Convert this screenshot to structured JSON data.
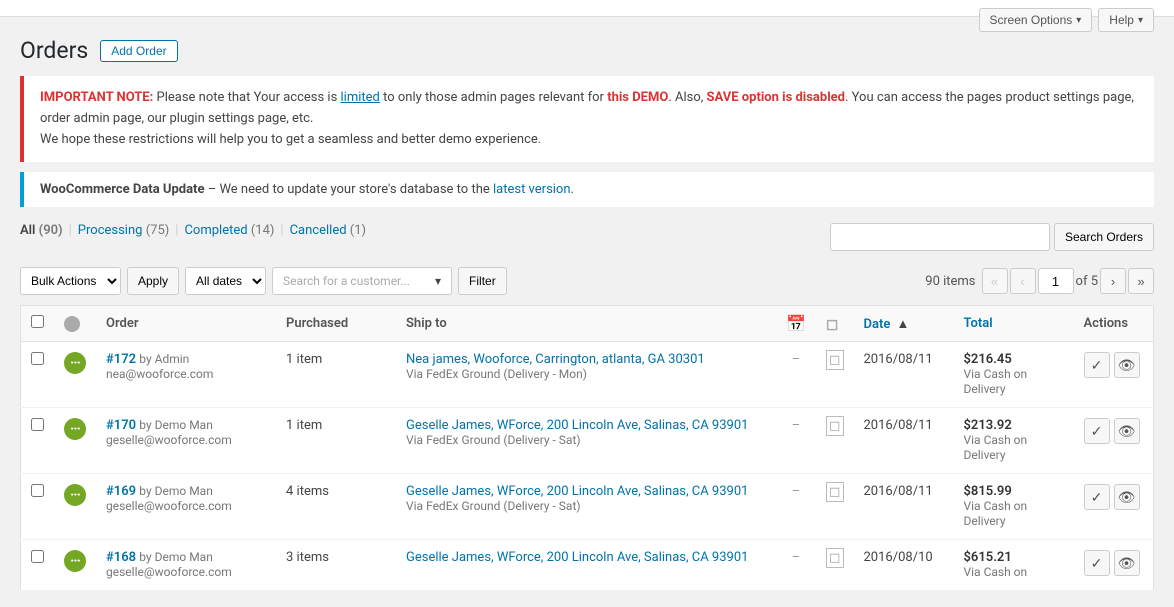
{
  "topBar": {
    "screenOptions": "Screen Options",
    "help": "Help"
  },
  "pageTitle": "Orders",
  "addOrderBtn": "Add Order",
  "notice": {
    "errorText1": "IMPORTANT NOTE: Please note that Your access is",
    "errorTextLink": "limited",
    "errorText2": "to only those admin pages relevant for",
    "errorTextStrong": "this DEMO",
    "errorText3": ". Also,",
    "errorTextStrong2": "SAVE option is disabled",
    "errorText4": ". You can access the pages product settings page, order admin page, our plugin settings page, etc.",
    "errorText5": "We hope these restrictions will help you to get a seamless and better demo experience."
  },
  "updateNotice": {
    "boldText": "WooCommerce Data Update",
    "text": " – We need to update your store's database to the",
    "linkText": "latest version",
    "period": "."
  },
  "filterTabs": [
    {
      "label": "All",
      "count": "90",
      "active": true
    },
    {
      "label": "Processing",
      "count": "75",
      "active": false
    },
    {
      "label": "Completed",
      "count": "14",
      "active": false
    },
    {
      "label": "Cancelled",
      "count": "1",
      "active": false
    }
  ],
  "actions": {
    "bulkActionsLabel": "Bulk Actions",
    "applyLabel": "Apply",
    "allDatesLabel": "All dates",
    "customerSearchPlaceholder": "Search for a customer...",
    "filterLabel": "Filter"
  },
  "pagination": {
    "itemsCount": "90 items",
    "currentPage": "1",
    "totalPages": "5"
  },
  "searchOrders": {
    "placeholder": "",
    "buttonLabel": "Search Orders"
  },
  "tableHeaders": {
    "order": "Order",
    "purchased": "Purchased",
    "shipTo": "Ship to",
    "date": "Date",
    "sortArrow": "▲",
    "total": "Total",
    "actions": "Actions"
  },
  "orders": [
    {
      "id": "#172",
      "by": "by Admin",
      "email": "nea@wooforce.com",
      "purchased": "1 item",
      "shipName": "Nea james, Wooforce, Carrington, atlanta, GA 30301",
      "shipVia": "Via FedEx Ground (Delivery - Mon)",
      "icon1": "–",
      "date": "2016/08/11",
      "total": "$216.45",
      "payment": "Via Cash on Delivery",
      "statusColor": "processing"
    },
    {
      "id": "#170",
      "by": "by Demo Man",
      "email": "geselle@wooforce.com",
      "purchased": "1 item",
      "shipName": "Geselle James, WForce, 200 Lincoln Ave, Salinas, CA 93901",
      "shipVia": "Via FedEx Ground (Delivery - Sat)",
      "icon1": "–",
      "date": "2016/08/11",
      "total": "$213.92",
      "payment": "Via Cash on Delivery",
      "statusColor": "processing"
    },
    {
      "id": "#169",
      "by": "by Demo Man",
      "email": "geselle@wooforce.com",
      "purchased": "4 items",
      "shipName": "Geselle James, WForce, 200 Lincoln Ave, Salinas, CA 93901",
      "shipVia": "Via FedEx Ground (Delivery - Sat)",
      "icon1": "–",
      "date": "2016/08/11",
      "total": "$815.99",
      "payment": "Via Cash on Delivery",
      "statusColor": "processing"
    },
    {
      "id": "#168",
      "by": "by Demo Man",
      "email": "geselle@wooforce.com",
      "purchased": "3 items",
      "shipName": "Geselle James, WForce, 200 Lincoln Ave, Salinas, CA 93901",
      "shipVia": "",
      "icon1": "–",
      "date": "2016/08/10",
      "total": "$615.21",
      "payment": "Via Cash on",
      "statusColor": "processing"
    }
  ]
}
